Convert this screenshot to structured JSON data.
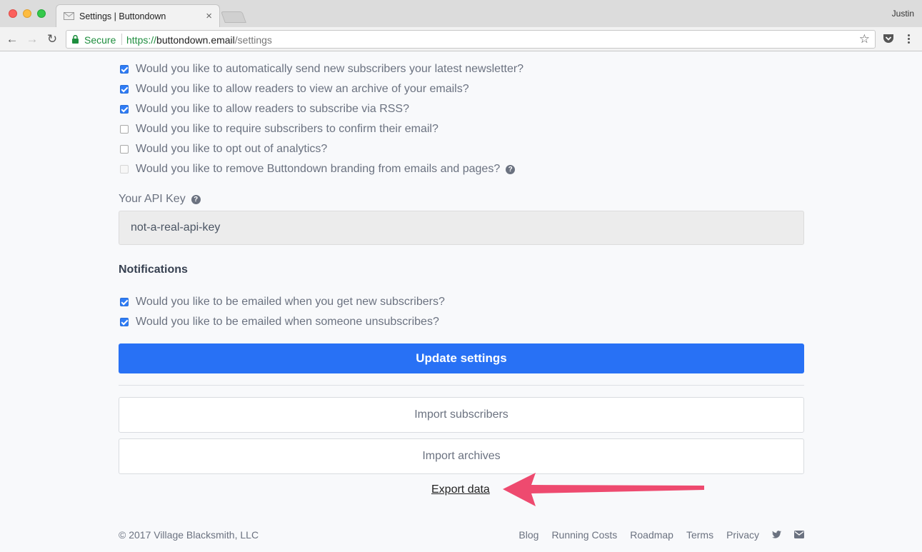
{
  "browser": {
    "tab_title": "Settings | Buttondown",
    "tab_close": "×",
    "profile_name": "Justin",
    "secure_label": "Secure",
    "url_scheme": "https://",
    "url_host": "buttondown.email",
    "url_path": "/settings",
    "icons": [
      "mail-favicon-icon",
      "close-icon",
      "back-arrow-icon",
      "forward-arrow-icon",
      "reload-icon",
      "lock-icon",
      "star-icon",
      "pocket-icon",
      "more-vert-icon"
    ]
  },
  "settings": {
    "options": [
      {
        "label": "Would you like to automatically send new subscribers your latest newsletter?",
        "checked": true
      },
      {
        "label": "Would you like to allow readers to view an archive of your emails?",
        "checked": true
      },
      {
        "label": "Would you like to allow readers to subscribe via RSS?",
        "checked": true
      },
      {
        "label": "Would you like to require subscribers to confirm their email?",
        "checked": false
      },
      {
        "label": "Would you like to opt out of analytics?",
        "checked": false
      },
      {
        "label": "Would you like to remove Buttondown branding from emails and pages?",
        "checked": false,
        "disabled": true,
        "help": true
      }
    ],
    "api_key_label": "Your API Key",
    "api_key_value": "not-a-real-api-key",
    "help_glyph": "?"
  },
  "notifications": {
    "heading": "Notifications",
    "options": [
      {
        "label": "Would you like to be emailed when you get new subscribers?",
        "checked": true
      },
      {
        "label": "Would you like to be emailed when someone unsubscribes?",
        "checked": true
      }
    ]
  },
  "actions": {
    "update_label": "Update settings",
    "import_subscribers_label": "Import subscribers",
    "import_archives_label": "Import archives",
    "export_label": "Export data"
  },
  "annotation": {
    "arrow_color": "#ee4a6f"
  },
  "footer": {
    "copyright": "© 2017 Village Blacksmith, LLC",
    "links": [
      "Blog",
      "Running Costs",
      "Roadmap",
      "Terms",
      "Privacy"
    ],
    "icons": [
      "twitter-icon",
      "email-icon"
    ]
  },
  "colors": {
    "primary": "#2871f5",
    "secure_green": "#1e8e3e",
    "text": "#6b7280"
  }
}
